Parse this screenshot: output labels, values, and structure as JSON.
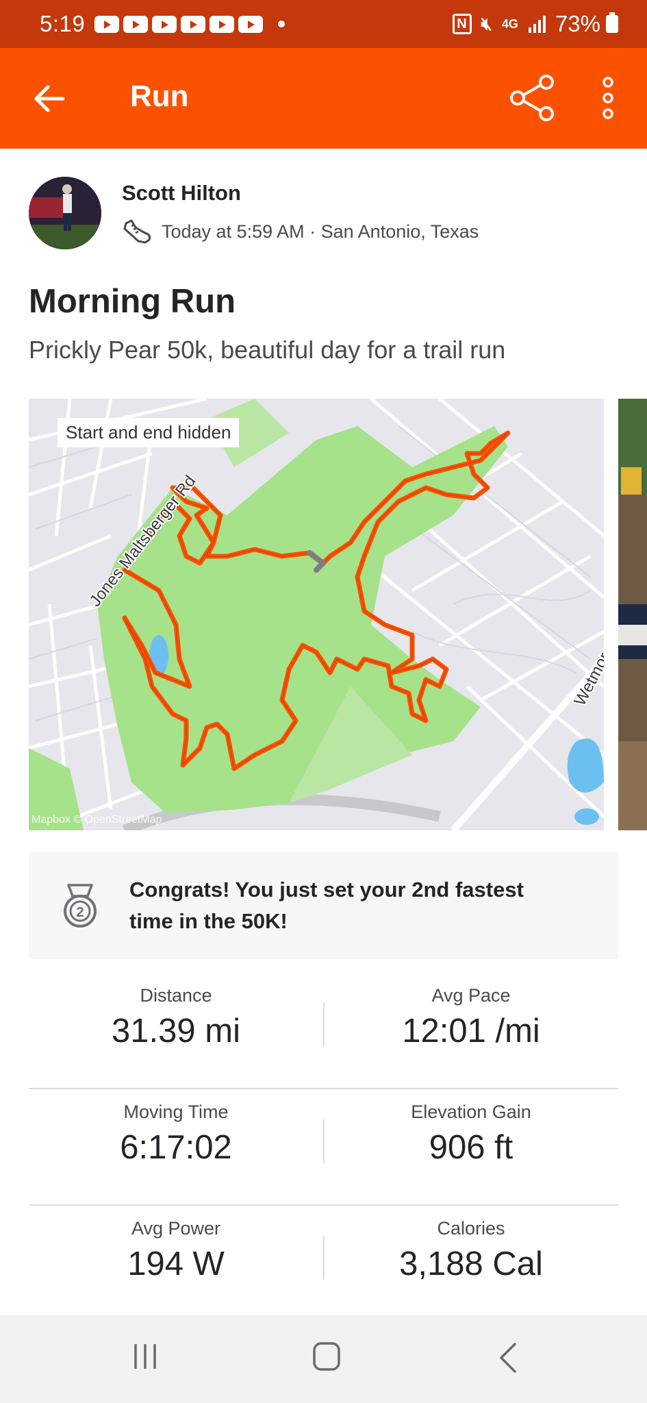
{
  "status_bar": {
    "time": "5:19",
    "battery": "73%",
    "network": "4G",
    "icons": [
      "youtube-icon",
      "youtube-icon",
      "youtube-icon",
      "youtube-icon",
      "youtube-icon",
      "youtube-icon",
      "nfc-icon",
      "mute-icon",
      "signal-icon",
      "battery-icon"
    ]
  },
  "app_bar": {
    "title": "Run",
    "back_icon": "arrow-left-icon",
    "share_icon": "share-icon",
    "more_icon": "more-vertical-icon"
  },
  "activity": {
    "athlete_name": "Scott Hilton",
    "timestamp_location": "Today at 5:59 AM · San Antonio, Texas",
    "title": "Morning Run",
    "description": "Prickly Pear 50k, beautiful day for a trail run"
  },
  "map": {
    "chip": "Start and end hidden",
    "road_label_1": "Jones Maltsberger Rd",
    "road_label_2": "Wetmore",
    "attribution": "Mapbox © OpenStreetMap",
    "route_color": "#fc5200"
  },
  "achievement": {
    "text": "Congrats! You just set your 2nd fastest time in the 50K!",
    "medal_number": "2"
  },
  "stats": [
    {
      "left": {
        "label": "Distance",
        "value": "31.39 mi"
      },
      "right": {
        "label": "Avg Pace",
        "value": "12:01 /mi"
      }
    },
    {
      "left": {
        "label": "Moving Time",
        "value": "6:17:02"
      },
      "right": {
        "label": "Elevation Gain",
        "value": "906 ft"
      }
    },
    {
      "left": {
        "label": "Avg Power",
        "value": "194 W"
      },
      "right": {
        "label": "Calories",
        "value": "3,188 Cal"
      }
    }
  ],
  "colors": {
    "brand": "#fc5200",
    "status_bar": "#c4380b",
    "park_green": "#a6e28a"
  }
}
